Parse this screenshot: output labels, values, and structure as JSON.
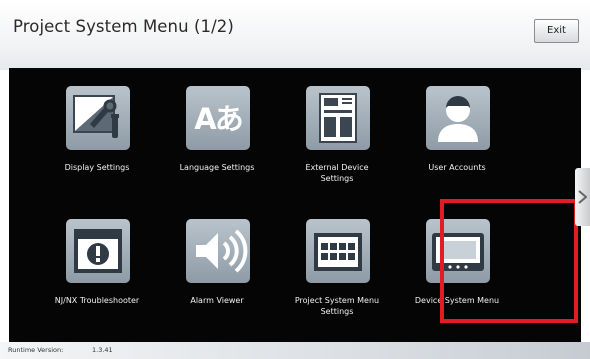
{
  "header": {
    "title": "Project System Menu (1/2)",
    "exit_label": "Exit"
  },
  "menu": {
    "items": [
      {
        "label": "Display Settings",
        "icon": "display-settings-icon"
      },
      {
        "label": "Language Settings",
        "icon": "language-icon",
        "glyph": "Aあ"
      },
      {
        "label": "External Device\nSettings",
        "icon": "external-device-icon"
      },
      {
        "label": "User Accounts",
        "icon": "user-icon"
      },
      {
        "label": "NJ/NX Troubleshooter",
        "icon": "troubleshooter-icon"
      },
      {
        "label": "Alarm Viewer",
        "icon": "speaker-icon"
      },
      {
        "label": "Project System Menu\nSettings",
        "icon": "keypad-icon"
      },
      {
        "label": "Device System Menu",
        "icon": "device-screen-icon"
      }
    ]
  },
  "highlight_color": "#e21c22",
  "footer": {
    "runtime_label": "Runtime Version:",
    "runtime_value": "1.3.41"
  }
}
